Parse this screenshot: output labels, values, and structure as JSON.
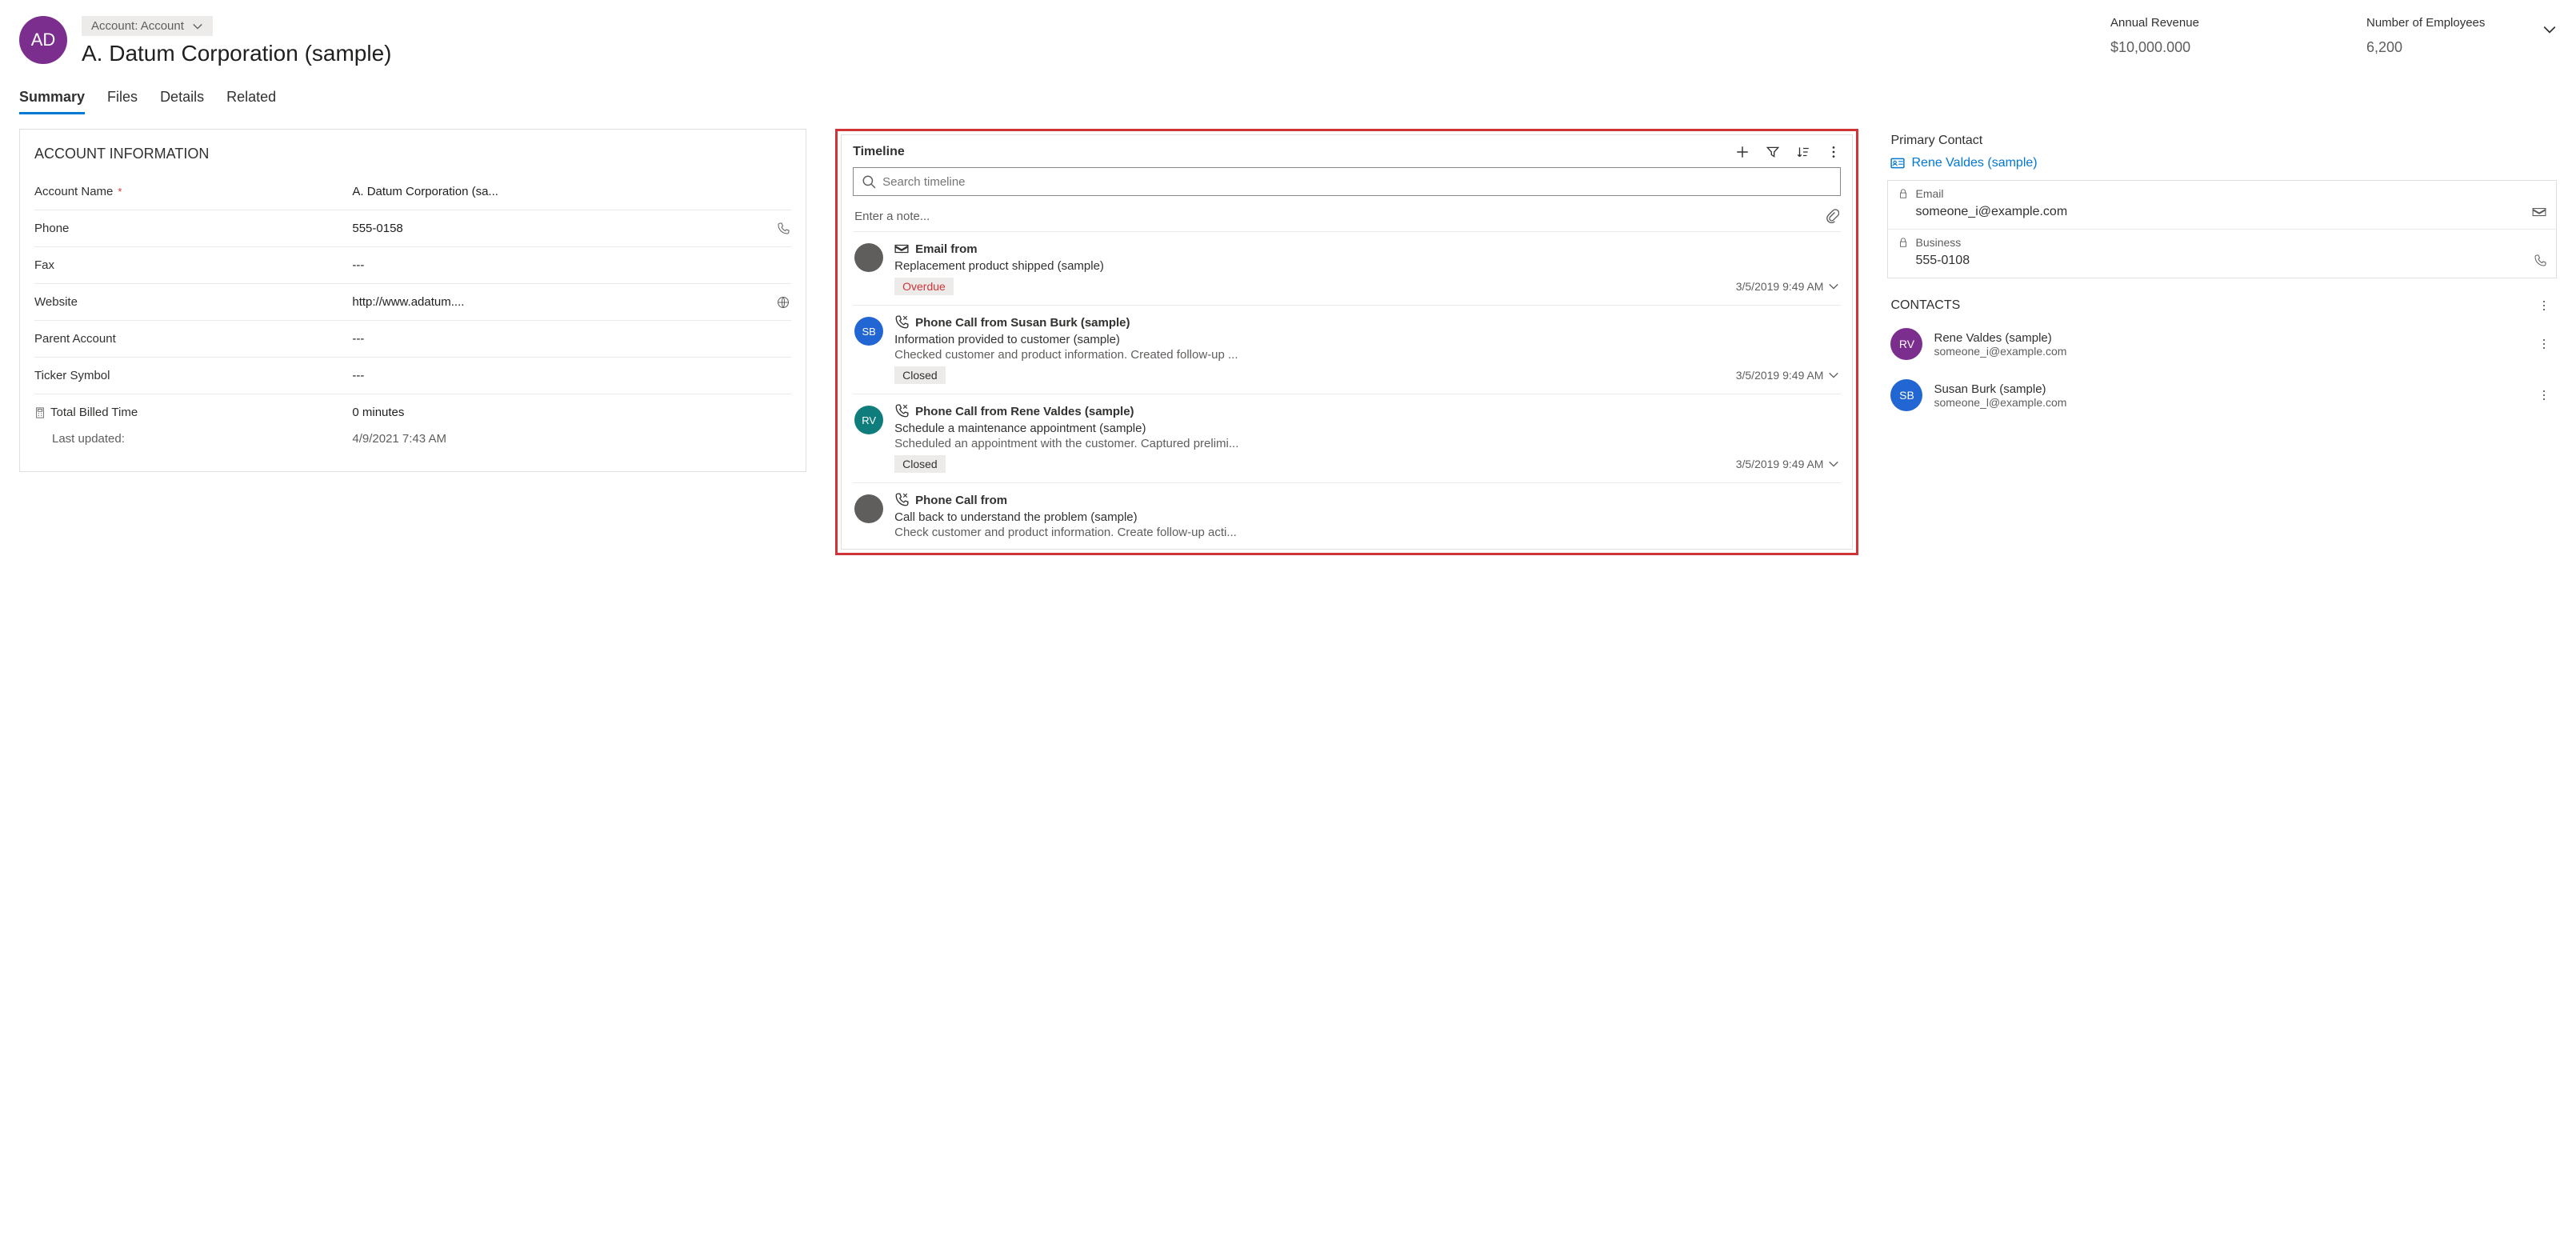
{
  "header": {
    "avatar_initials": "AD",
    "entity_label": "Account: Account",
    "record_title": "A. Datum Corporation (sample)",
    "metrics": [
      {
        "label": "Annual Revenue",
        "value": "$10,000.000"
      },
      {
        "label": "Number of Employees",
        "value": "6,200"
      }
    ]
  },
  "tabs": [
    "Summary",
    "Files",
    "Details",
    "Related"
  ],
  "active_tab": 0,
  "account_info": {
    "title": "ACCOUNT INFORMATION",
    "fields": {
      "account_name": {
        "label": "Account Name",
        "value": "A. Datum Corporation (sa...",
        "required": true
      },
      "phone": {
        "label": "Phone",
        "value": "555-0158"
      },
      "fax": {
        "label": "Fax",
        "value": "---"
      },
      "website": {
        "label": "Website",
        "value": "http://www.adatum...."
      },
      "parent": {
        "label": "Parent Account",
        "value": "---"
      },
      "ticker": {
        "label": "Ticker Symbol",
        "value": "---"
      },
      "billed": {
        "label": "Total Billed Time",
        "value": "0 minutes"
      },
      "updated": {
        "label": "Last updated:",
        "value": "4/9/2021 7:43 AM"
      }
    }
  },
  "timeline": {
    "title": "Timeline",
    "search_placeholder": "Search timeline",
    "note_placeholder": "Enter a note...",
    "items": [
      {
        "avatar_initials": "",
        "avatar_color": "#605e5c",
        "type_icon": "email",
        "title": "Email from",
        "subject": "Replacement product shipped (sample)",
        "notes": "",
        "status": "Overdue",
        "status_kind": "overdue",
        "date": "3/5/2019 9:49 AM"
      },
      {
        "avatar_initials": "SB",
        "avatar_color": "#2266d3",
        "type_icon": "phone",
        "title": "Phone Call from Susan Burk (sample)",
        "subject": "Information provided to customer (sample)",
        "notes": "Checked customer and product information. Created follow-up ...",
        "status": "Closed",
        "status_kind": "closed",
        "date": "3/5/2019 9:49 AM"
      },
      {
        "avatar_initials": "RV",
        "avatar_color": "#0f7d7b",
        "type_icon": "phone",
        "title": "Phone Call from Rene Valdes (sample)",
        "subject": "Schedule a maintenance appointment (sample)",
        "notes": "Scheduled an appointment with the customer. Captured prelimi...",
        "status": "Closed",
        "status_kind": "closed",
        "date": "3/5/2019 9:49 AM"
      },
      {
        "avatar_initials": "",
        "avatar_color": "#605e5c",
        "type_icon": "phone",
        "title": "Phone Call from",
        "subject": "Call back to understand the problem (sample)",
        "notes": "Check customer and product information. Create follow-up acti...",
        "status": "",
        "status_kind": "",
        "date": ""
      }
    ]
  },
  "primary_contact": {
    "title": "Primary Contact",
    "name": "Rene Valdes (sample)",
    "email": {
      "label": "Email",
      "value": "someone_i@example.com"
    },
    "business": {
      "label": "Business",
      "value": "555-0108"
    }
  },
  "contacts": {
    "title": "CONTACTS",
    "list": [
      {
        "initials": "RV",
        "color": "#7b2e8e",
        "name": "Rene Valdes (sample)",
        "email": "someone_i@example.com"
      },
      {
        "initials": "SB",
        "color": "#2266d3",
        "name": "Susan Burk (sample)",
        "email": "someone_l@example.com"
      }
    ]
  }
}
